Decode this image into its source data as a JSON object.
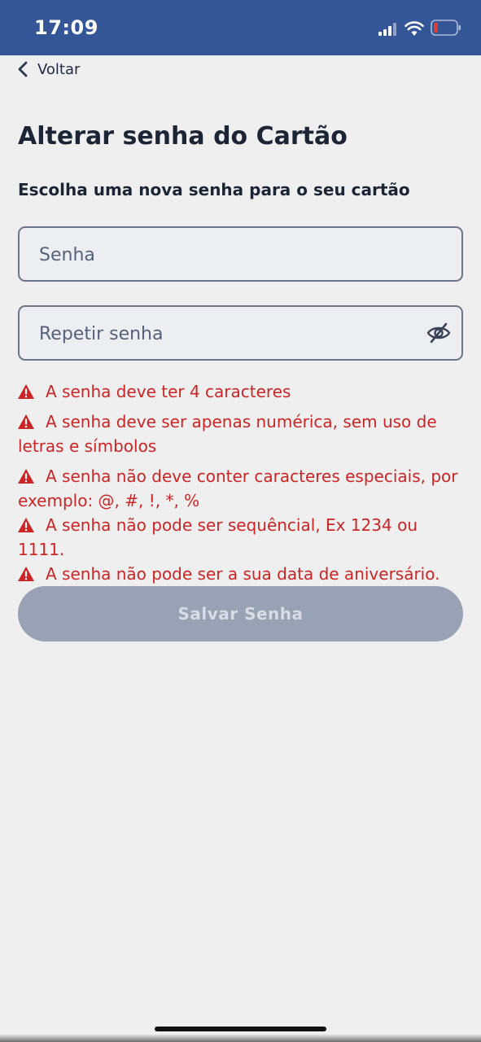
{
  "status_bar": {
    "time": "17:09",
    "icons": [
      "signal-icon",
      "wifi-icon",
      "battery-low-icon"
    ],
    "background": "#345696"
  },
  "nav": {
    "back_label": "Voltar",
    "icon": "chevron-left-icon"
  },
  "header": {
    "title": "Alterar senha do Cartão",
    "subtitle": "Escolha uma nova senha para o seu cartão"
  },
  "form": {
    "password": {
      "placeholder": "Senha",
      "value": ""
    },
    "repeat_password": {
      "placeholder": "Repetir senha",
      "value": "",
      "toggle_icon": "eye-slash-icon"
    }
  },
  "errors": [
    "A senha deve ter 4 caracteres",
    "A senha deve ser apenas numérica, sem uso de letras e símbolos",
    "A senha não deve conter caracteres especiais, por exemplo: @, #, !, *, %",
    "A senha não pode ser sequêncial, Ex 1234 ou 1111.",
    "A senha não pode ser a sua data de aniversário."
  ],
  "error_icon": "warning-icon",
  "error_color": "#cc2525",
  "save_button": {
    "label": "Salvar Senha",
    "disabled": true,
    "color": "#98a2b4"
  }
}
